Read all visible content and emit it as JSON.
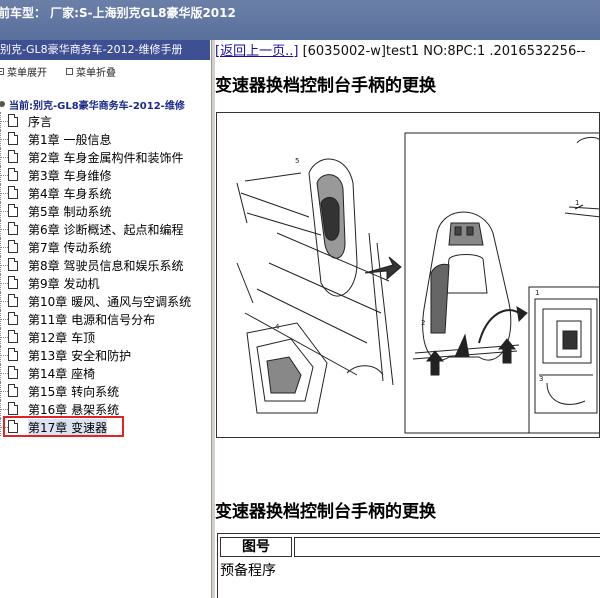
{
  "titlebar": {
    "text": "前车型：  厂家:S-上海别克GL8豪华版2012"
  },
  "left_pane": {
    "header": "别克-GL8豪华商务车-2012-维修手册",
    "toolbar": {
      "expand_label": "菜单展开",
      "collapse_label": "菜单折叠"
    },
    "root_label": "当前:别克-GL8豪华商务车-2012-维修",
    "items": [
      {
        "label": "序言"
      },
      {
        "label": "第1章 一般信息"
      },
      {
        "label": "第2章 车身金属构件和装饰件"
      },
      {
        "label": "第3章 车身维修"
      },
      {
        "label": "第4章 车身系统"
      },
      {
        "label": "第5章 制动系统"
      },
      {
        "label": "第6章 诊断概述、起点和编程"
      },
      {
        "label": "第7章 传动系统"
      },
      {
        "label": "第8章 驾驶员信息和娱乐系统"
      },
      {
        "label": "第9章 发动机"
      },
      {
        "label": "第10章 暖风、通风与空调系统"
      },
      {
        "label": "第11章 电源和信号分布"
      },
      {
        "label": "第12章 车顶"
      },
      {
        "label": "第13章 安全和防护"
      },
      {
        "label": "第14章 座椅"
      },
      {
        "label": "第15章 转向系统"
      },
      {
        "label": "第16章 悬架系统"
      },
      {
        "label": "第17章 变速器"
      }
    ],
    "selected_index": 17
  },
  "right_pane": {
    "back_link": "[返回上一页..]",
    "doc_meta": "[6035002-w]test1 NO:8PC:1 .2016532256--",
    "heading_top": "变速器换档控制台手柄的更换",
    "heading_bottom": "变速器换档控制台手柄的更换",
    "table": {
      "header": "图号",
      "body": "预备程序"
    },
    "figure_callouts": [
      "5",
      "4",
      "1",
      "2",
      "1",
      "3"
    ]
  }
}
